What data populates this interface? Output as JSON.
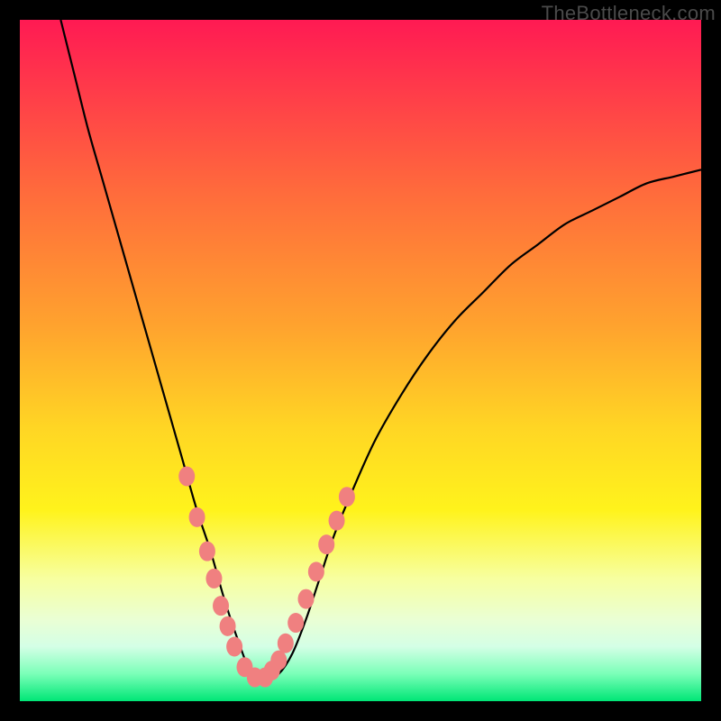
{
  "watermark": "TheBottleneck.com",
  "colors": {
    "curve": "#000000",
    "marker_fill": "#f08080",
    "marker_stroke": "#c95d5d",
    "gradient_top": "#ff1a53",
    "gradient_bottom": "#00e676",
    "frame": "#000000"
  },
  "chart_data": {
    "type": "line",
    "title": "",
    "xlabel": "",
    "ylabel": "",
    "xlim": [
      0,
      100
    ],
    "ylim": [
      0,
      100
    ],
    "curve": {
      "description": "V-shaped bottleneck curve dropping to minimum near x≈34 then rising",
      "x": [
        6,
        8,
        10,
        12,
        14,
        16,
        18,
        20,
        22,
        24,
        26,
        28,
        30,
        32,
        34,
        36,
        38,
        40,
        42,
        44,
        46,
        48,
        52,
        56,
        60,
        64,
        68,
        72,
        76,
        80,
        84,
        88,
        92,
        96,
        100
      ],
      "y": [
        100,
        92,
        84,
        77,
        70,
        63,
        56,
        49,
        42,
        35,
        28,
        22,
        15,
        9,
        4,
        3,
        4,
        7,
        12,
        18,
        24,
        29,
        38,
        45,
        51,
        56,
        60,
        64,
        67,
        70,
        72,
        74,
        76,
        77,
        78
      ]
    },
    "series": [
      {
        "name": "left-branch-markers",
        "x": [
          24.5,
          26,
          27.5,
          28.5,
          29.5,
          30.5,
          31.5,
          33,
          34.5
        ],
        "y": [
          33,
          27,
          22,
          18,
          14,
          11,
          8,
          5,
          3.5
        ]
      },
      {
        "name": "right-branch-markers",
        "x": [
          36,
          37,
          38,
          39,
          40.5,
          42,
          43.5,
          45,
          46.5,
          48
        ],
        "y": [
          3.5,
          4.5,
          6,
          8.5,
          11.5,
          15,
          19,
          23,
          26.5,
          30
        ]
      }
    ]
  }
}
